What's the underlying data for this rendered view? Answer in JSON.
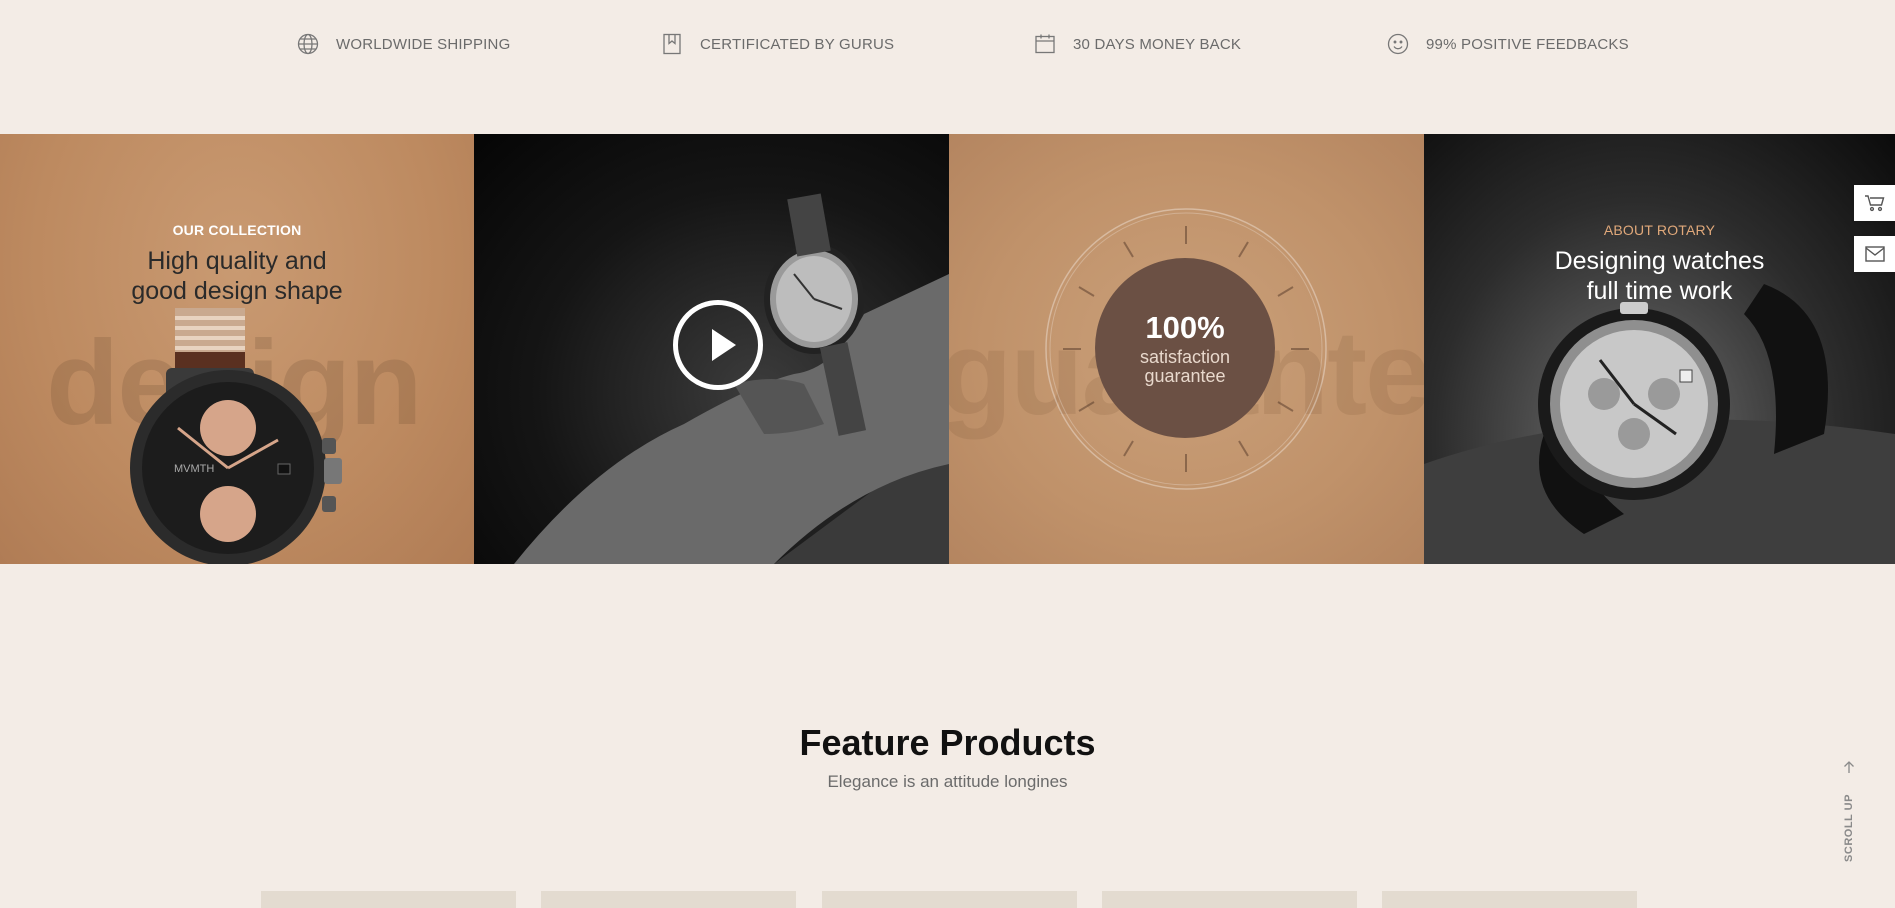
{
  "features": [
    {
      "icon": "globe-icon",
      "label": "WORLDWIDE SHIPPING"
    },
    {
      "icon": "bookmark-icon",
      "label": "CERTIFICATED BY GURUS"
    },
    {
      "icon": "calendar-icon",
      "label": "30 DAYS MONEY BACK"
    },
    {
      "icon": "smiley-icon",
      "label": "99% POSITIVE FEEDBACKS"
    }
  ],
  "banner": {
    "collection": {
      "eyebrow": "OUR COLLECTION",
      "headline_line1": "High quality and",
      "headline_line2": "good design shape",
      "bg_word": "design",
      "image": "watch-product-image"
    },
    "video": {
      "image": "wrist-watch-photo",
      "play_icon": "play-icon"
    },
    "guarantee": {
      "big": "100%",
      "line1": "satisfaction",
      "line2": "guarantee",
      "bg_word": "guarantee"
    },
    "about": {
      "eyebrow": "ABOUT ROTARY",
      "headline_line1": "Designing watches",
      "headline_line2": "full time work",
      "image": "chronograph-watch-photo"
    }
  },
  "side_buttons": [
    {
      "icon": "cart-icon"
    },
    {
      "icon": "mail-icon"
    }
  ],
  "feature_products": {
    "title": "Feature Products",
    "subtitle": "Elegance is an attitude longines"
  },
  "scroll_up": {
    "label": "SCROLL UP",
    "icon": "arrow-up-icon"
  },
  "colors": {
    "background": "#f3ece6",
    "tan": "#c0926a",
    "accent_orange": "#e0a87a",
    "guarantee_circle": "#6b5044",
    "card_placeholder": "#e3dbd0"
  }
}
